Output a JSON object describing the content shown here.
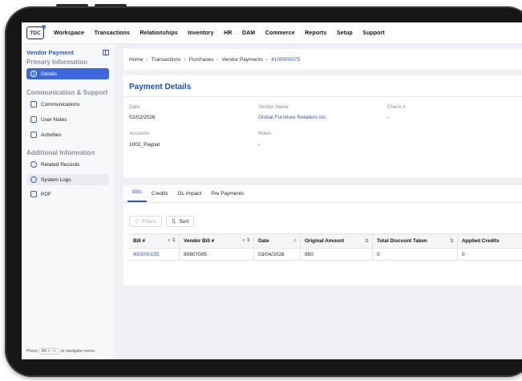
{
  "nav": {
    "logo_text": "TDC",
    "links": [
      "Workspace",
      "Transactions",
      "Relationships",
      "Inventory",
      "HR",
      "DAM",
      "Commerce",
      "Reports",
      "Setup",
      "Support"
    ]
  },
  "sidebar": {
    "title": "Vendor Payment",
    "sections": [
      {
        "label": "Primary Information",
        "items": [
          {
            "label": "Details",
            "icon": "info-icon"
          }
        ]
      },
      {
        "label": "Communication & Support",
        "items": [
          {
            "label": "Communications",
            "icon": "chat-icon"
          },
          {
            "label": "User Notes",
            "icon": "note-icon"
          },
          {
            "label": "Activities",
            "icon": "activity-icon"
          }
        ]
      },
      {
        "label": "Additional Information",
        "items": [
          {
            "label": "Related Records",
            "icon": "link-icon"
          },
          {
            "label": "System Logs",
            "icon": "history-icon"
          },
          {
            "label": "PDF",
            "icon": "pdf-icon"
          }
        ]
      }
    ],
    "footer": {
      "prefix": "Press",
      "shortcut": "Alt + ↑/↓",
      "suffix": "to navigate menu"
    }
  },
  "breadcrumb": {
    "items": [
      "Home",
      "Transactions",
      "Purchases",
      "Vendor Payments"
    ],
    "current": "4100000075"
  },
  "payment_details": {
    "title": "Payment Details",
    "fields": {
      "date_label": "Date",
      "date_value": "02/02/2026",
      "vendor_label": "Vendor Name",
      "vendor_value": "Global Furniture Retailers Inc.",
      "check_label": "Check #",
      "check_value": "-",
      "accounts_label": "Accounts",
      "accounts_value": "1002_Paypal",
      "notes_label": "Notes",
      "notes_value": "-"
    }
  },
  "tabs": [
    "Bills",
    "Credits",
    "GL Impact",
    "Pre Payments"
  ],
  "toolbar": {
    "filters_label": "Filters",
    "sort_label": "Sort"
  },
  "table": {
    "columns": [
      "Bill #",
      "Vendor Bill #",
      "Date",
      "Original Amount",
      "Total Discount Taken",
      "Applied Credits"
    ],
    "rows": [
      [
        "400000155",
        "90807005",
        "03/04/2026",
        "950",
        "0",
        "0"
      ]
    ]
  },
  "colors": {
    "accent": "#2f57c8",
    "active_item": "#3b67e0"
  }
}
